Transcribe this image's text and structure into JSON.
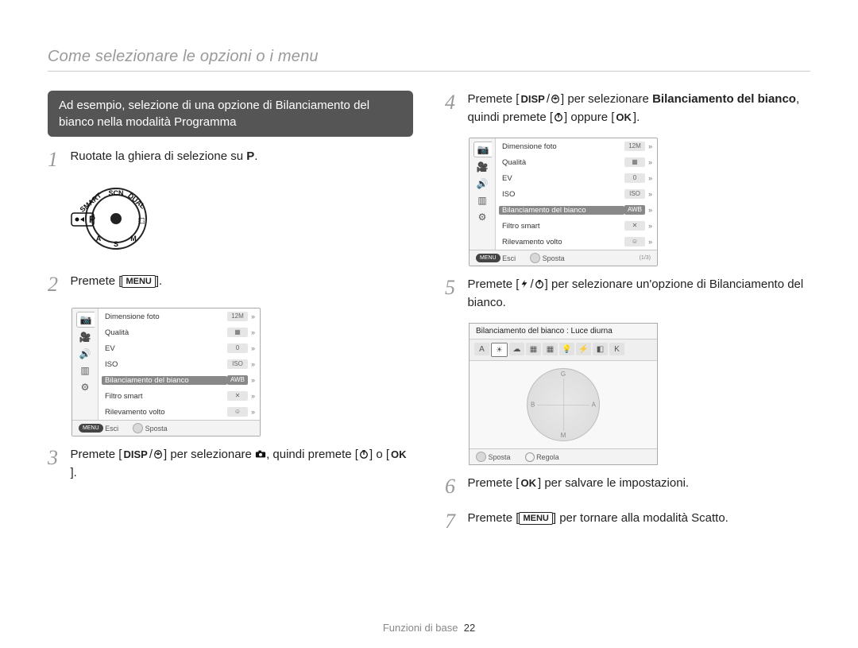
{
  "header": "Come selezionare le opzioni o i menu",
  "noteBox": "Ad esempio, selezione di una opzione di Bilanciamento del bianco nella modalità Programma",
  "labels": {
    "disp": "DISP",
    "menu": "MENU",
    "ok": "OK"
  },
  "steps": {
    "s1": {
      "num": "1",
      "pre": "Ruotate la ghiera di selezione su ",
      "mode": "P",
      "post": "."
    },
    "s2": {
      "num": "2",
      "pre": "Premete [",
      "post": "]."
    },
    "s3": {
      "num": "3",
      "p1": "Premete [",
      "p2": "/",
      "p3": "] per selezionare ",
      "p4": ", quindi premete [",
      "p5": "] o [",
      "p6": "]."
    },
    "s4": {
      "num": "4",
      "p1": "Premete [",
      "p2": "/",
      "p3": "] per selezionare ",
      "bold": "Bilanciamento del bianco",
      "p4": ", quindi premete [",
      "p5": "] oppure [",
      "p6": "]."
    },
    "s5": {
      "num": "5",
      "p1": "Premete [",
      "p2": "/",
      "p3": "] per selezionare un'opzione di Bilanciamento del bianco."
    },
    "s6": {
      "num": "6",
      "p1": "Premete [",
      "p2": "] per salvare le impostazioni."
    },
    "s7": {
      "num": "7",
      "p1": "Premete [",
      "p2": "] per tornare alla modalità Scatto."
    }
  },
  "menuScreen": {
    "rows": [
      {
        "label": "Dimensione foto",
        "value": "12M"
      },
      {
        "label": "Qualità",
        "value": "▦"
      },
      {
        "label": "EV",
        "value": "0"
      },
      {
        "label": "ISO",
        "value": "ISO"
      },
      {
        "label": "Bilanciamento del bianco",
        "value": "AWB",
        "selected": true
      },
      {
        "label": "Filtro smart",
        "value": "✕"
      },
      {
        "label": "Rilevamento volto",
        "value": "☺"
      }
    ],
    "footer": {
      "btn1": "Esci",
      "btn2": "Sposta",
      "page": "(1/3)"
    }
  },
  "wbScreen": {
    "title": "Bilanciamento del bianco : Luce diurna",
    "axes": {
      "g": "G",
      "m": "M",
      "a": "A",
      "b": "B"
    },
    "footer": {
      "btn1": "Sposta",
      "btn2": "Regola"
    }
  },
  "footer": {
    "text": "Funzioni di base",
    "page": "22"
  }
}
